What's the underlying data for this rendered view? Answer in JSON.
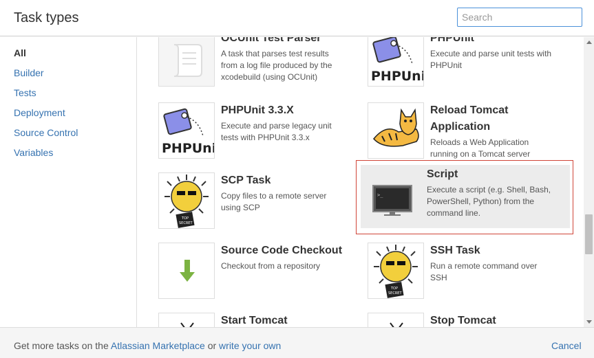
{
  "header": {
    "title": "Task types",
    "search_placeholder": "Search"
  },
  "sidebar": {
    "items": [
      {
        "label": "All",
        "active": true
      },
      {
        "label": "Builder"
      },
      {
        "label": "Tests"
      },
      {
        "label": "Deployment"
      },
      {
        "label": "Source Control"
      },
      {
        "label": "Variables"
      }
    ]
  },
  "tasks": {
    "ocunit": {
      "name": "OCUnit Test Parser",
      "desc1": "A task that parses test results",
      "desc2": "from a log file produced by the",
      "desc3": "xcodebuild (using OCUnit)",
      "icon": "scroll-icon"
    },
    "phpunit": {
      "name": "PHPUnit",
      "desc1": "Execute and parse unit tests with",
      "desc2": "PHPUnit",
      "icon_text": "PHPUnit"
    },
    "phpunit33": {
      "name": "PHPUnit 3.3.X",
      "desc1": "Execute and parse legacy unit",
      "desc2": "tests with PHPUnit 3.3.x",
      "icon_text": "PHPUnit"
    },
    "reload_tomcat": {
      "name1": "Reload Tomcat",
      "name2": "Application",
      "desc1": "Reloads a Web Application",
      "desc2": "running on a Tomcat server"
    },
    "scp": {
      "name": "SCP Task",
      "desc1": "Copy files to a remote server",
      "desc2": "using SCP",
      "badge1": "TOP",
      "badge2": "SECRET"
    },
    "script": {
      "name": "Script",
      "desc1": "Execute a script (e.g. Shell, Bash,",
      "desc2": "PowerShell, Python) from the",
      "desc3": "command line.",
      "prompt": ">_"
    },
    "checkout": {
      "name": "Source Code Checkout",
      "desc1": "Checkout from a repository"
    },
    "ssh": {
      "name": "SSH Task",
      "desc1": "Run a remote command over",
      "desc2": "SSH",
      "badge1": "TOP",
      "badge2": "SECRET"
    },
    "start_tomcat": {
      "name": "Start Tomcat"
    },
    "stop_tomcat": {
      "name": "Stop Tomcat"
    }
  },
  "footer": {
    "prefix": "Get more tasks on the ",
    "marketplace_link": "Atlassian Marketplace",
    "middle": " or ",
    "write_link": "write your own",
    "cancel": "Cancel"
  },
  "colors": {
    "link": "#3572b0",
    "selected_border": "#d04437",
    "selected_bg": "#ececec"
  }
}
